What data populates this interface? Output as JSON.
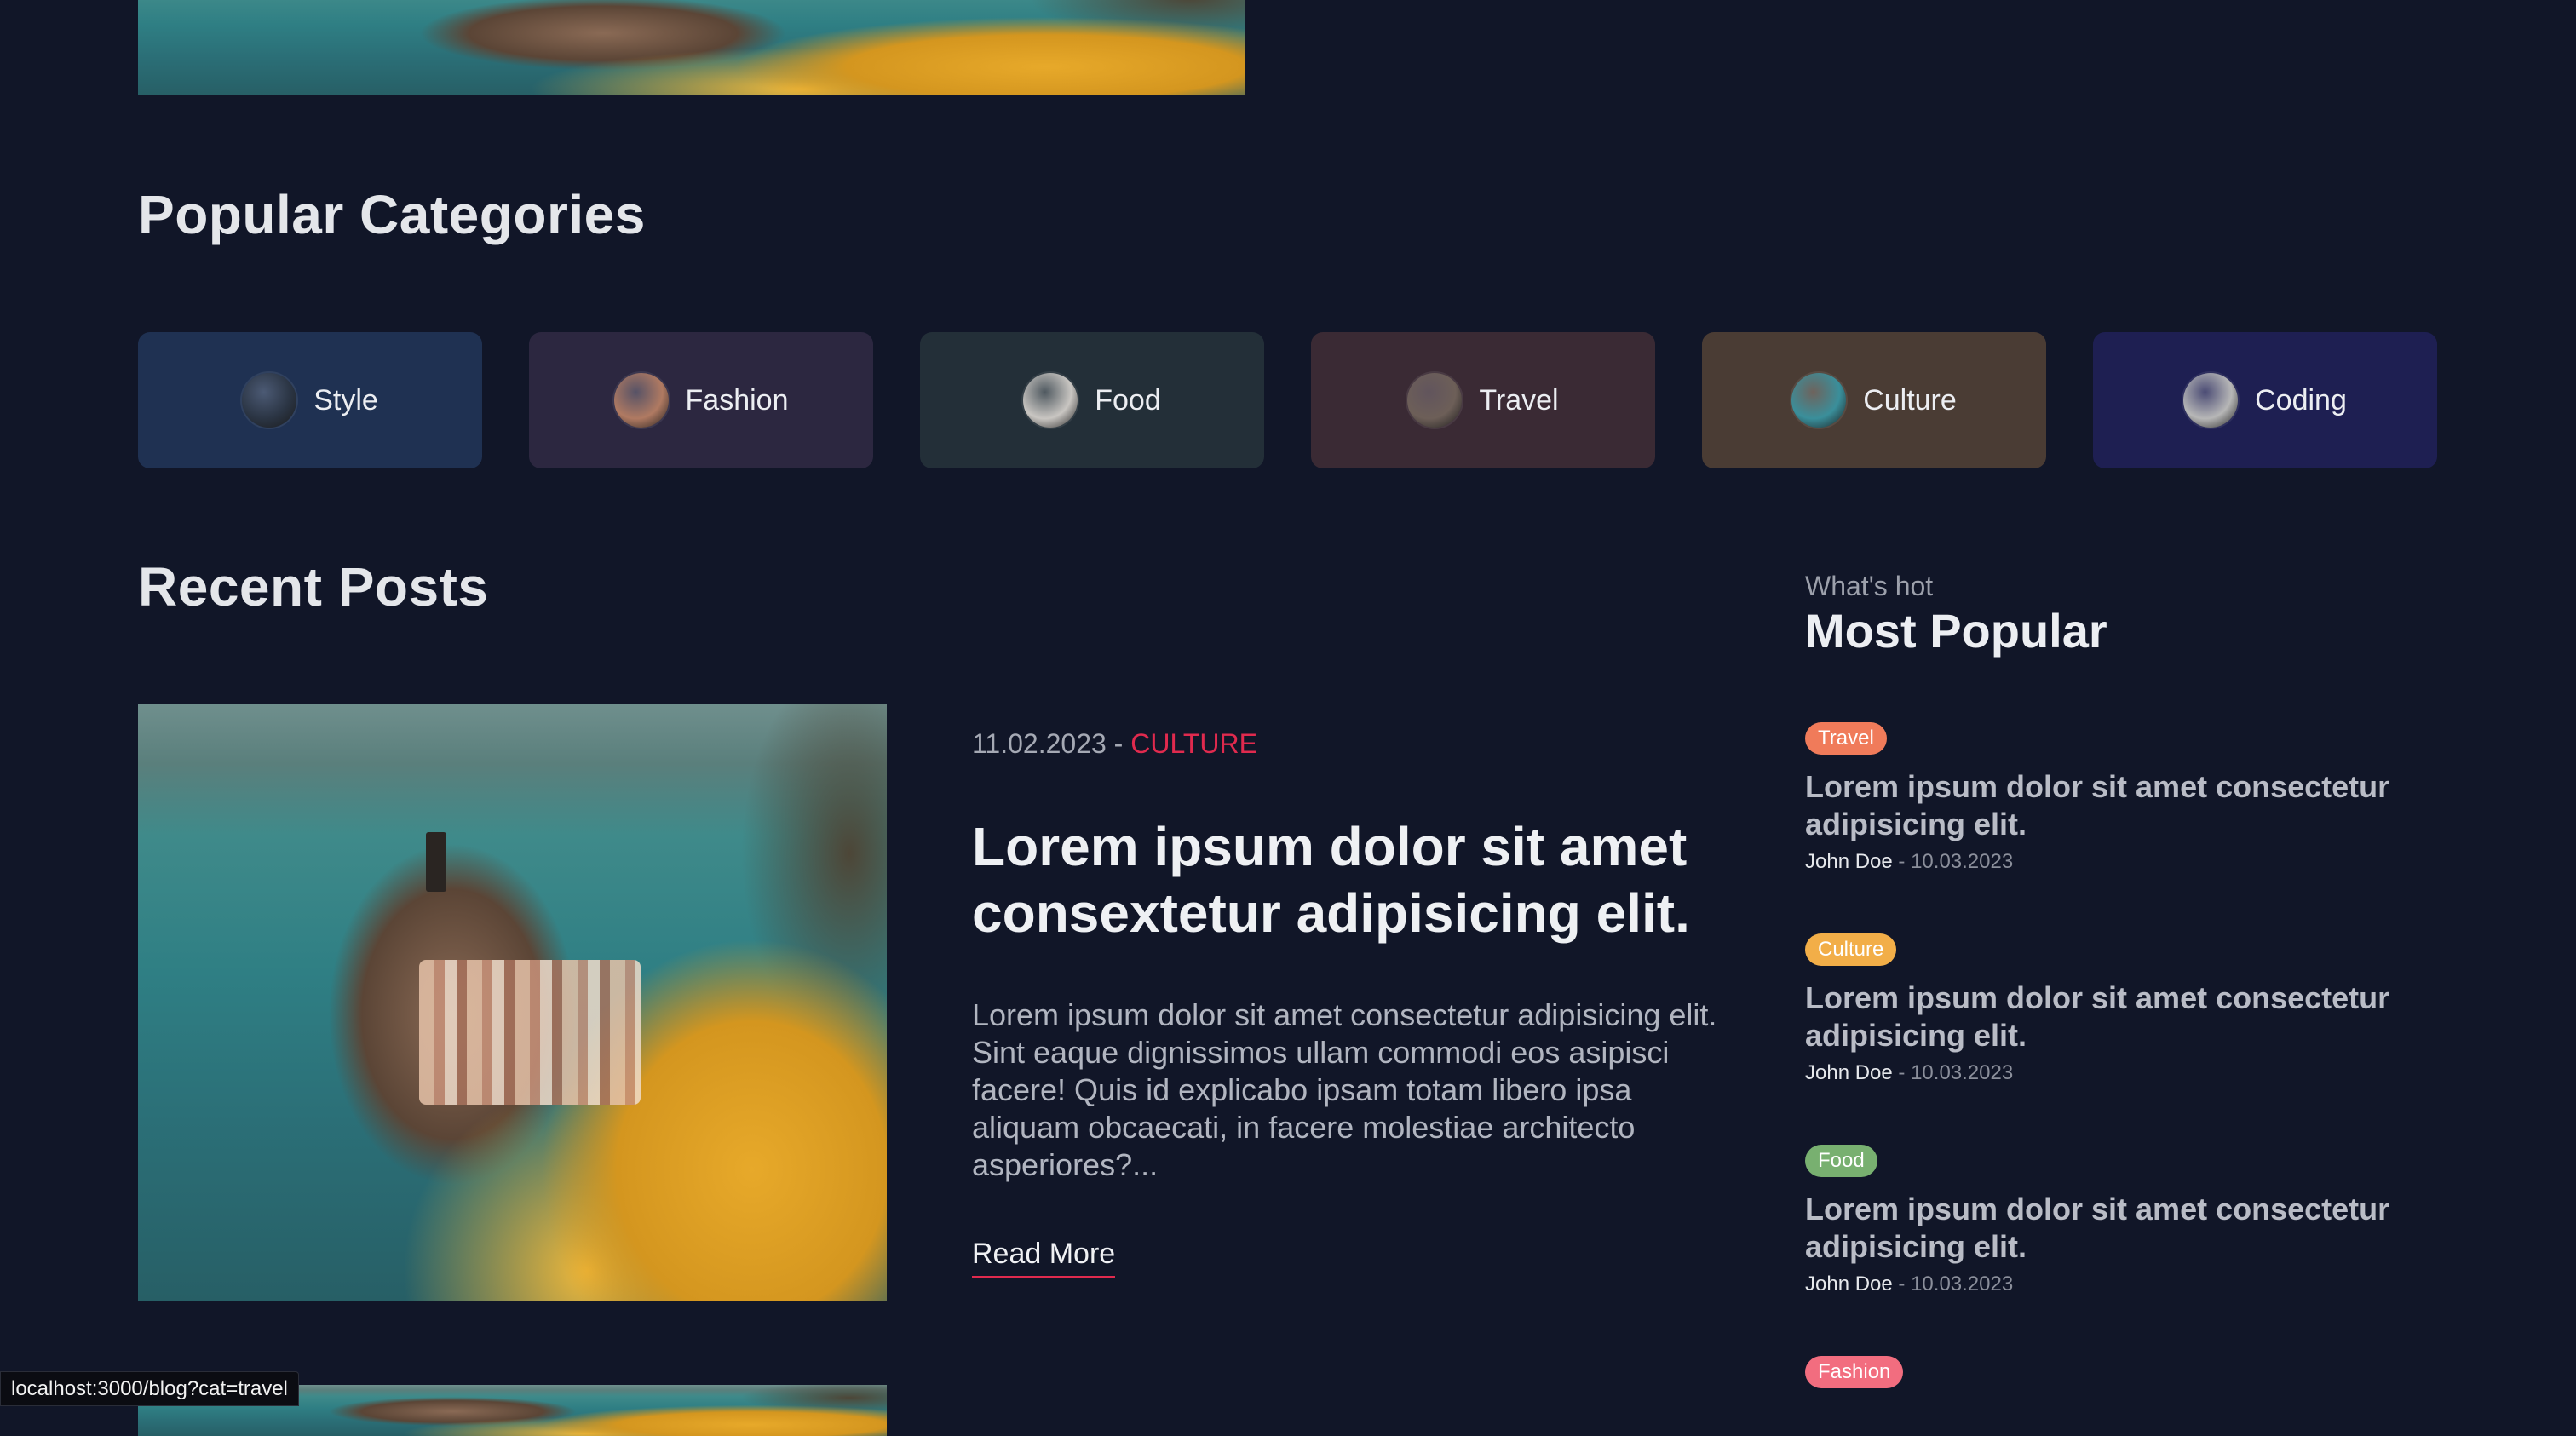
{
  "sections": {
    "categories_title": "Popular Categories",
    "recent_title": "Recent Posts"
  },
  "categories": [
    {
      "label": "Style",
      "bg": "#1f3152",
      "avatar": "#2b3544"
    },
    {
      "label": "Fashion",
      "bg": "#2c2740",
      "avatar": "#b07a62"
    },
    {
      "label": "Food",
      "bg": "#232f38",
      "avatar": "#c9c6c2"
    },
    {
      "label": "Travel",
      "bg": "#3a2a34",
      "avatar": "#6d5f58"
    },
    {
      "label": "Culture",
      "bg": "#4a3c34",
      "avatar": "#3a8f9b"
    },
    {
      "label": "Coding",
      "bg": "#1e1f52",
      "avatar": "#b7b7b7"
    }
  ],
  "post": {
    "date": "11.02.2023 - ",
    "category": "CULTURE",
    "title": "Lorem ipsum dolor sit amet consextetur adipisicing elit.",
    "excerpt": "Lorem ipsum dolor sit amet consectetur adipisicing elit. Sint eaque dignissimos ullam commodi eos asipisci facere! Quis id explicabo ipsam totam libero ipsa aliquam obcaecati, in facere molestiae architecto asperiores?...",
    "read_more": "Read More"
  },
  "sidebar": {
    "kicker": "What's hot",
    "title": "Most Popular",
    "items": [
      {
        "tag": "Travel",
        "tag_color": "#f07b5a",
        "title": "Lorem ipsum dolor sit amet consectetur adipisicing elit.",
        "author": "John Doe",
        "date": " - 10.03.2023"
      },
      {
        "tag": "Culture",
        "tag_color": "#f2ae48",
        "title": "Lorem ipsum dolor sit amet consectetur adipisicing elit.",
        "author": "John Doe",
        "date": " - 10.03.2023"
      },
      {
        "tag": "Food",
        "tag_color": "#78b070",
        "title": "Lorem ipsum dolor sit amet consectetur adipisicing elit.",
        "author": "John Doe",
        "date": " - 10.03.2023"
      },
      {
        "tag": "Fashion",
        "tag_color": "#f26d7f"
      }
    ]
  },
  "status_bar": {
    "url": "localhost:3000/blog?cat=travel"
  }
}
